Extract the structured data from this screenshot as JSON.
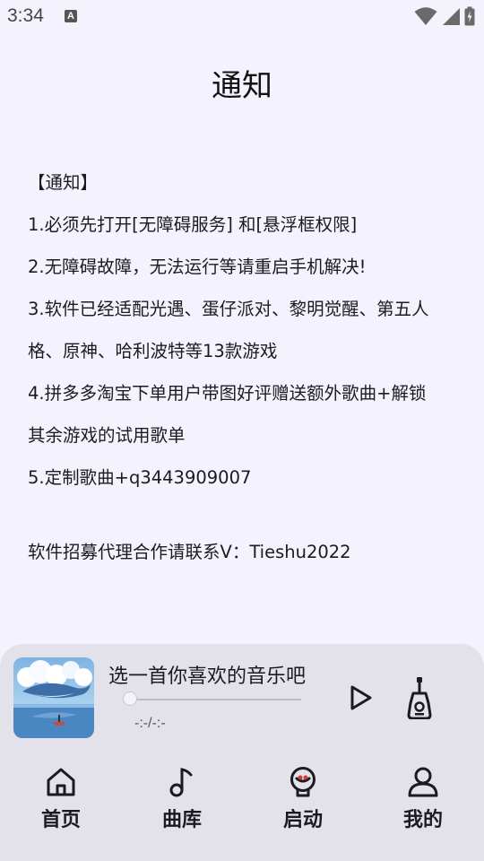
{
  "status": {
    "time": "3:34",
    "a_icon_letter": "A"
  },
  "page": {
    "title": "通知"
  },
  "notice": {
    "lines": [
      "【通知】",
      "1.必须先打开[无障碍服务] 和[悬浮框权限]",
      "2.无障碍故障，无法运行等请重启手机解决!",
      "3.软件已经适配光遇、蛋仔派对、黎明觉醒、第五人",
      "格、原神、哈利波特等13款游戏",
      "4.拼多多淘宝下单用户带图好评赠送额外歌曲+解锁",
      "其余游戏的试用歌单",
      "5.定制歌曲+q3443909007"
    ],
    "contact": "软件招募代理合作请联系V：Tieshu2022"
  },
  "player": {
    "song_title": "选一首你喜欢的音乐吧",
    "time": "-:-/-:-",
    "progress": 0
  },
  "nav": {
    "items": [
      {
        "label": "首页",
        "icon": "home-icon"
      },
      {
        "label": "曲库",
        "icon": "music-note-icon"
      },
      {
        "label": "启动",
        "icon": "launch-icon"
      },
      {
        "label": "我的",
        "icon": "user-icon"
      }
    ]
  },
  "colors": {
    "background": "#f4f3fd",
    "card": "#e3e2ea",
    "text": "#1b1b1f"
  }
}
